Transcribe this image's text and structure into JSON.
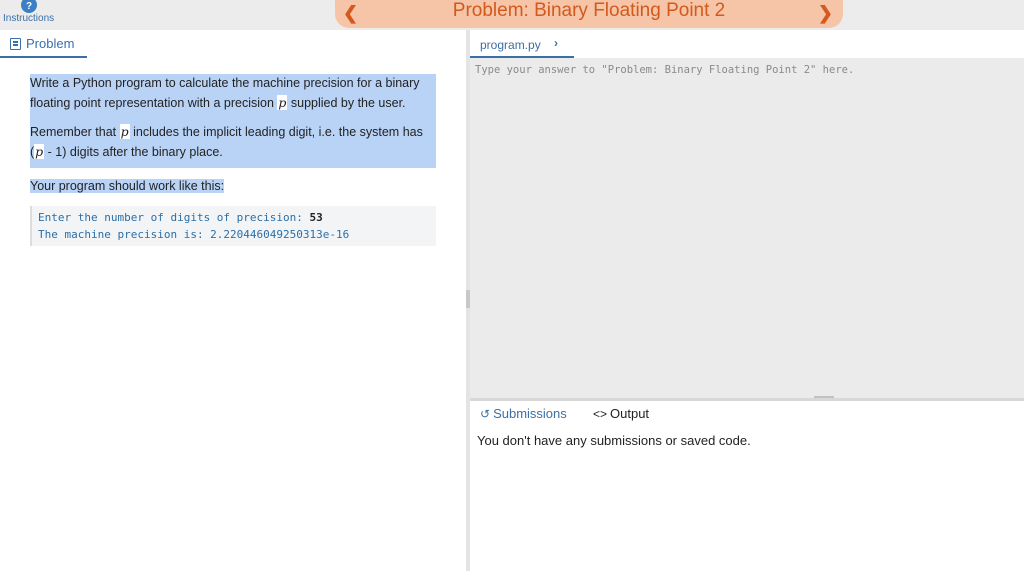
{
  "topbar": {
    "instructions_label": "Instructions",
    "help_icon": "help-circle-icon",
    "title": "Problem: Binary Floating Point 2",
    "prev_icon": "chevron-left-icon",
    "next_icon": "chevron-right-icon",
    "accent_color": "#d25a1e",
    "pill_color": "#f6c4a6"
  },
  "left": {
    "tab_label": "Problem",
    "tab_icon": "document-icon",
    "p1_a": "Write a Python program to calculate the machine precision for a binary floating point representation with a precision ",
    "p1_var": "p",
    "p1_b": " supplied by the user.",
    "p2_a": "Remember that ",
    "p2_var": "p",
    "p2_b": " includes the implicit leading digit, i.e. the system has (",
    "p2_var2": "p",
    "p2_c": " - 1) digits after the binary place.",
    "p3": "Your program should work like this:",
    "code_line1_prompt": "Enter the number of digits of precision: ",
    "code_line1_input": "53",
    "code_line2": "The machine precision is: 2.220446049250313e-16"
  },
  "right": {
    "file_tab": "program.py",
    "file_chevron_icon": "chevron-right-icon",
    "editor_placeholder": "Type your answer to \"Problem: Binary Floating Point 2\" here.",
    "tab_submissions": "Submissions",
    "tab_submissions_icon": "history-icon",
    "tab_output": "Output",
    "tab_output_icon": "code-icon",
    "empty_message": "You don't have any submissions or saved code."
  }
}
